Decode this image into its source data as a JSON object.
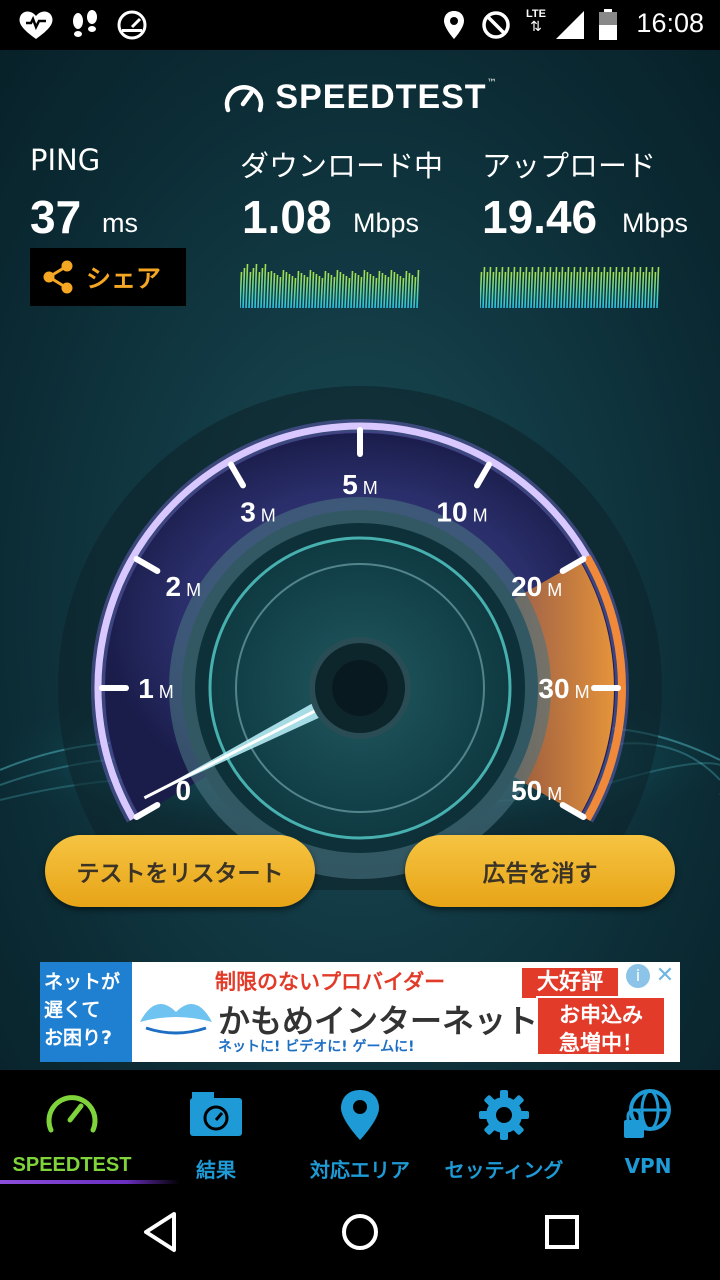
{
  "status_bar": {
    "time": "16:08",
    "network_label": "LTE",
    "left_icons": [
      "heart-icon",
      "footprints-icon",
      "speedometer-notification-icon"
    ],
    "right_icons": [
      "location-icon",
      "do-not-disturb-icon",
      "lte-signal-icon",
      "signal-icon",
      "battery-icon"
    ]
  },
  "brand": {
    "title": "SPEEDTEST",
    "tm": "™"
  },
  "metrics": {
    "ping": {
      "label": "PING",
      "value": "37",
      "unit": "ms"
    },
    "download": {
      "label": "ダウンロード中",
      "value": "1.08",
      "unit": "Mbps"
    },
    "upload": {
      "label": "アップロード",
      "value": "19.46",
      "unit": "Mbps"
    }
  },
  "share_button": {
    "label": "シェア"
  },
  "gauge": {
    "scale_labels": [
      "0",
      "1M",
      "2M",
      "3M",
      "5M",
      "10M",
      "20M",
      "30M",
      "50M"
    ],
    "scale_values_mbps": [
      0,
      1,
      2,
      3,
      5,
      10,
      20,
      30,
      50
    ],
    "needle_value_mbps": 0.1,
    "upload_highlight_range_mbps": [
      20,
      50
    ],
    "colors": {
      "arc": "#d8c8ff",
      "upload_highlight": "#f08a3a",
      "needle": "#bff6ff"
    }
  },
  "buttons": {
    "restart": "テストをリスタート",
    "remove_ads": "広告を消す"
  },
  "ad": {
    "side_text": [
      "ネットが",
      "遅くて",
      "お困り?"
    ],
    "headline": "制限のないプロバイダー",
    "brand": "かもめインターネット",
    "links": "ネットに! ビデオに! ゲームに!",
    "badge_top": "大好評",
    "badge_main": [
      "お申込み",
      "急増中！"
    ],
    "info": "i",
    "close": "✕"
  },
  "bottom_nav": {
    "items": [
      {
        "label": "SPEEDTEST",
        "icon": "speedometer-icon",
        "active": true
      },
      {
        "label": "結果",
        "icon": "results-folder-icon",
        "active": false
      },
      {
        "label": "対応エリア",
        "icon": "map-pin-icon",
        "active": false
      },
      {
        "label": "セッティング",
        "icon": "gear-icon",
        "active": false
      },
      {
        "label": "VPN",
        "icon": "vpn-lock-globe-icon",
        "active": false
      }
    ],
    "active_color": "#7fd43b",
    "inactive_color": "#1e9bd6"
  },
  "system_nav": {
    "buttons": [
      "back-icon",
      "home-icon",
      "recents-icon"
    ]
  }
}
